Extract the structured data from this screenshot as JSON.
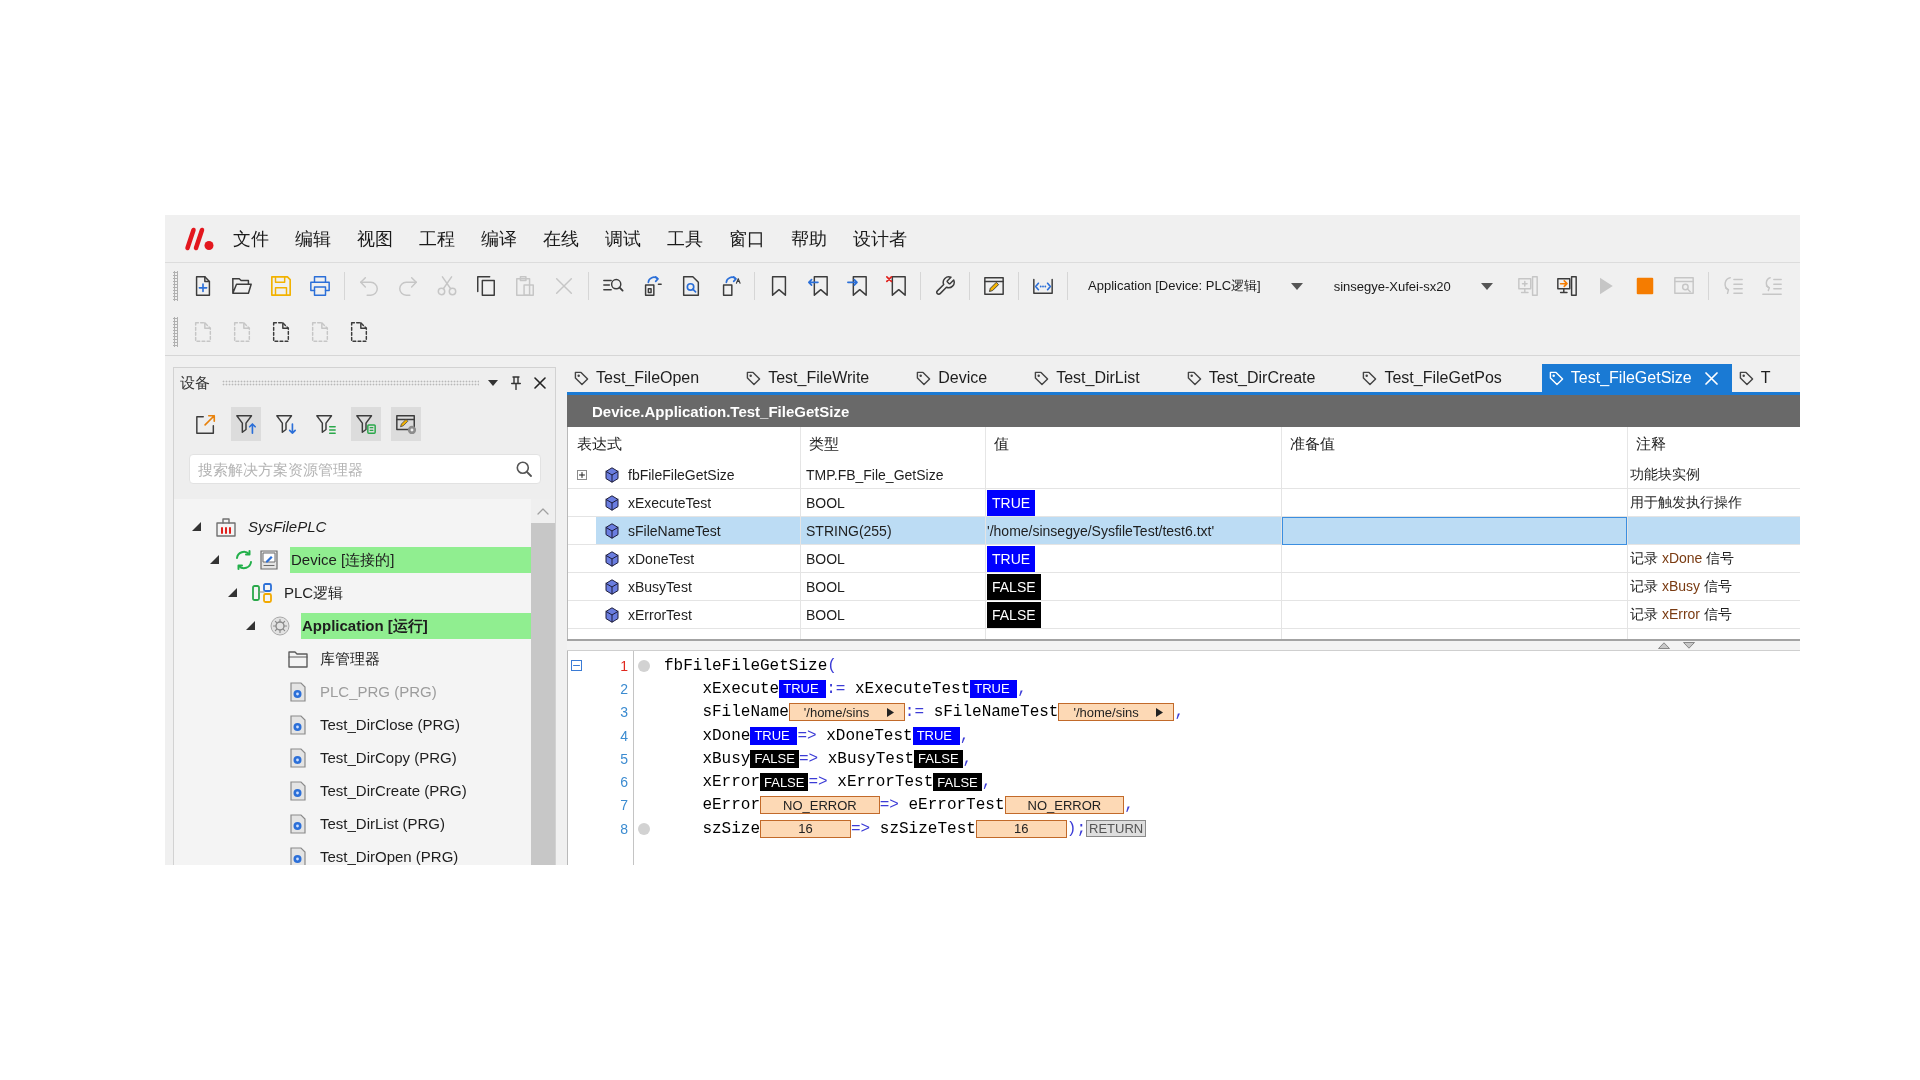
{
  "menu": [
    "文件",
    "编辑",
    "视图",
    "工程",
    "编译",
    "在线",
    "调试",
    "工具",
    "窗口",
    "帮助",
    "设计者"
  ],
  "toolbar": {
    "rows": [
      {
        "groups": [
          {
            "items": [
              {
                "kind": "new",
                "disabled": false
              },
              {
                "kind": "open",
                "disabled": false
              },
              {
                "kind": "save",
                "disabled": false
              },
              {
                "kind": "print",
                "disabled": false
              }
            ]
          },
          {
            "items": [
              {
                "kind": "undo",
                "disabled": true
              },
              {
                "kind": "redo",
                "disabled": true
              },
              {
                "kind": "cut",
                "disabled": true
              },
              {
                "kind": "copy",
                "disabled": false
              },
              {
                "kind": "paste",
                "disabled": true
              },
              {
                "kind": "delete",
                "disabled": true
              }
            ]
          },
          {
            "items": [
              {
                "kind": "find",
                "disabled": false
              },
              {
                "kind": "box_arrow",
                "disabled": false
              },
              {
                "kind": "page_search",
                "disabled": false
              },
              {
                "kind": "page_arrow",
                "disabled": false
              }
            ]
          },
          {
            "items": [
              {
                "kind": "bookmark",
                "disabled": false
              },
              {
                "kind": "bookmark_prev",
                "disabled": false
              },
              {
                "kind": "bookmark_next",
                "disabled": false
              },
              {
                "kind": "bookmark_clear",
                "disabled": false
              }
            ]
          },
          {
            "items": [
              {
                "kind": "wrench",
                "disabled": false
              }
            ]
          },
          {
            "items": [
              {
                "kind": "window_pencil",
                "disabled": false
              }
            ]
          },
          {
            "items": [
              {
                "kind": "code_bracket",
                "disabled": false
              }
            ]
          },
          {
            "items": [
              {
                "kind": "dropdown",
                "text": "Application [Device: PLC逻辑]"
              },
              {
                "kind": "dropdown",
                "text": "sinsegye-Xufei-sx20"
              },
              {
                "kind": "login",
                "disabled": true
              },
              {
                "kind": "logout",
                "disabled": false
              },
              {
                "kind": "run",
                "disabled": true
              },
              {
                "kind": "stop",
                "disabled": false
              },
              {
                "kind": "window_search",
                "disabled": true
              }
            ]
          },
          {
            "items": [
              {
                "kind": "step_into",
                "disabled": true
              },
              {
                "kind": "step_over",
                "disabled": true
              }
            ]
          }
        ]
      },
      {
        "groups": [
          {
            "items": [
              {
                "kind": "dashed_page",
                "disabled": true
              },
              {
                "kind": "dashed_page",
                "disabled": true
              },
              {
                "kind": "dashed_page",
                "disabled": false
              },
              {
                "kind": "dashed_page",
                "disabled": true
              },
              {
                "kind": "dashed_page",
                "disabled": false
              }
            ]
          }
        ]
      }
    ]
  },
  "devices": {
    "title": "设备",
    "tools": [
      {
        "kind": "export",
        "active": false
      },
      {
        "kind": "filter_up",
        "active": true
      },
      {
        "kind": "filter_down",
        "active": false
      },
      {
        "kind": "filter_lines",
        "active": false
      },
      {
        "kind": "filter_box",
        "active": true
      },
      {
        "kind": "window_gear",
        "active": true
      }
    ],
    "search": {
      "placeholder": "搜索解决方案资源管理器"
    },
    "tree": [
      {
        "label": "SysFilePLC",
        "kind": "project",
        "highlighted": false,
        "disabled": false,
        "active": false,
        "expanded": true,
        "children": [
          {
            "label": "Device [连接的]",
            "kind": "device",
            "highlighted": true,
            "disabled": false,
            "active": false,
            "expanded": true,
            "children": [
              {
                "label": "PLC逻辑",
                "kind": "plc_logic",
                "highlighted": false,
                "disabled": false,
                "active": false,
                "expanded": true,
                "children": [
                  {
                    "label": "Application [运行]",
                    "kind": "application",
                    "highlighted": true,
                    "disabled": false,
                    "active": true,
                    "expanded": true,
                    "children": [
                      {
                        "label": "库管理器",
                        "kind": "library",
                        "highlighted": false,
                        "disabled": false,
                        "active": false
                      },
                      {
                        "label": "PLC_PRG (PRG)",
                        "kind": "program",
                        "highlighted": false,
                        "disabled": true,
                        "active": false
                      },
                      {
                        "label": "Test_DirClose (PRG)",
                        "kind": "program",
                        "highlighted": false,
                        "disabled": false,
                        "active": false
                      },
                      {
                        "label": "Test_DirCopy (PRG)",
                        "kind": "program",
                        "highlighted": false,
                        "disabled": false,
                        "active": false
                      },
                      {
                        "label": "Test_DirCreate (PRG)",
                        "kind": "program",
                        "highlighted": false,
                        "disabled": false,
                        "active": false
                      },
                      {
                        "label": "Test_DirList (PRG)",
                        "kind": "program",
                        "highlighted": false,
                        "disabled": false,
                        "active": false
                      },
                      {
                        "label": "Test_DirOpen (PRG)",
                        "kind": "program",
                        "highlighted": false,
                        "disabled": false,
                        "active": false
                      }
                    ]
                  }
                ]
              }
            ]
          }
        ]
      }
    ]
  },
  "tabs": [
    {
      "label": "Test_FileOpen",
      "selected": false
    },
    {
      "label": "Test_FileWrite",
      "selected": false
    },
    {
      "label": "Device",
      "selected": false
    },
    {
      "label": "Test_DirList",
      "selected": false
    },
    {
      "label": "Test_DirCreate",
      "selected": false
    },
    {
      "label": "Test_FileGetPos",
      "selected": false
    },
    {
      "label": "Test_FileGetSize",
      "selected": true
    },
    {
      "label": "T",
      "selected": false
    }
  ],
  "editor": {
    "title": "Device.Application.Test_FileGetSize",
    "columns": [
      "表达式",
      "类型",
      "值",
      "准备值",
      "注释"
    ],
    "rows": [
      {
        "expression": "fbFileFileGetSize",
        "type": "TMP.FB_File_GetSize",
        "expanded": false,
        "selected": false,
        "comment": [
          {
            "text": "功能块实例",
            "kind": "text"
          }
        ]
      },
      {
        "expression": "xExecuteTest",
        "type": "BOOL",
        "value": {
          "text": "TRUE",
          "kind": "true"
        },
        "selected": false,
        "comment": [
          {
            "text": "用于触发执行操作",
            "kind": "text"
          }
        ]
      },
      {
        "expression": "sFileNameTest",
        "type": "STRING(255)",
        "value": {
          "text": "'/home/sinsegye/SysfileTest/test6.txt'",
          "kind": "text"
        },
        "selected": true
      },
      {
        "expression": "xDoneTest",
        "type": "BOOL",
        "value": {
          "text": "TRUE",
          "kind": "true"
        },
        "selected": false,
        "comment": [
          {
            "text": "记录 ",
            "kind": "text"
          },
          {
            "text": "xDone",
            "kind": "identifier"
          },
          {
            "text": " 信号",
            "kind": "text"
          }
        ]
      },
      {
        "expression": "xBusyTest",
        "type": "BOOL",
        "value": {
          "text": "FALSE",
          "kind": "false"
        },
        "selected": false,
        "comment": [
          {
            "text": "记录 ",
            "kind": "text"
          },
          {
            "text": "xBusy",
            "kind": "identifier"
          },
          {
            "text": " 信号",
            "kind": "text"
          }
        ]
      },
      {
        "expression": "xErrorTest",
        "type": "BOOL",
        "value": {
          "text": "FALSE",
          "kind": "false"
        },
        "selected": false,
        "comment": [
          {
            "text": "记录 ",
            "kind": "text"
          },
          {
            "text": "xError",
            "kind": "identifier"
          },
          {
            "text": " 信号",
            "kind": "text"
          }
        ]
      }
    ],
    "code": [
      {
        "number": "1",
        "current": true,
        "breakpoint": true,
        "expanded": true,
        "tokens": [
          {
            "text": "fbFileFileGetSize",
            "kind": "ident"
          },
          {
            "text": "(",
            "kind": "op"
          }
        ],
        "children": [
          {
            "number": "2",
            "current": false,
            "breakpoint": false,
            "tokens": [
              {
                "text": "xExecute",
                "kind": "ident"
              },
              {
                "text": "TRUE",
                "kind": "true"
              },
              {
                "text": ":= ",
                "kind": "op"
              },
              {
                "text": "xExecuteTest",
                "kind": "ident"
              },
              {
                "text": "TRUE",
                "kind": "true"
              },
              {
                "text": ",",
                "kind": "op"
              }
            ]
          },
          {
            "number": "3",
            "current": false,
            "breakpoint": false,
            "tokens": [
              {
                "text": "sFileName",
                "kind": "ident"
              },
              {
                "text": "'/home/sins",
                "kind": "string"
              },
              {
                "text": ":= ",
                "kind": "op"
              },
              {
                "text": "sFileNameTest",
                "kind": "ident"
              },
              {
                "text": "'/home/sins",
                "kind": "string"
              },
              {
                "text": ",",
                "kind": "op"
              }
            ]
          },
          {
            "number": "4",
            "current": false,
            "breakpoint": false,
            "tokens": [
              {
                "text": "xDone",
                "kind": "ident"
              },
              {
                "text": "TRUE",
                "kind": "true"
              },
              {
                "text": "=> ",
                "kind": "op"
              },
              {
                "text": "xDoneTest",
                "kind": "ident"
              },
              {
                "text": "TRUE",
                "kind": "true"
              },
              {
                "text": ",",
                "kind": "op"
              }
            ]
          },
          {
            "number": "5",
            "current": false,
            "breakpoint": false,
            "tokens": [
              {
                "text": "xBusy",
                "kind": "ident"
              },
              {
                "text": "FALSE",
                "kind": "false"
              },
              {
                "text": "=> ",
                "kind": "op"
              },
              {
                "text": "xBusyTest",
                "kind": "ident"
              },
              {
                "text": "FALSE",
                "kind": "false"
              },
              {
                "text": ",",
                "kind": "op"
              }
            ]
          },
          {
            "number": "6",
            "current": false,
            "breakpoint": false,
            "tokens": [
              {
                "text": "xError",
                "kind": "ident"
              },
              {
                "text": "FALSE",
                "kind": "false"
              },
              {
                "text": "=> ",
                "kind": "op"
              },
              {
                "text": "xErrorTest",
                "kind": "ident"
              },
              {
                "text": "FALSE",
                "kind": "false"
              },
              {
                "text": ",",
                "kind": "op"
              }
            ]
          },
          {
            "number": "7",
            "current": false,
            "breakpoint": false,
            "tokens": [
              {
                "text": "eError",
                "kind": "ident"
              },
              {
                "text": "NO_ERROR",
                "kind": "value"
              },
              {
                "text": "=> ",
                "kind": "op"
              },
              {
                "text": "eErrorTest",
                "kind": "ident"
              },
              {
                "text": "NO_ERROR",
                "kind": "value"
              },
              {
                "text": ",",
                "kind": "op"
              }
            ]
          },
          {
            "number": "8",
            "current": false,
            "breakpoint": true,
            "tokens": [
              {
                "text": "szSize",
                "kind": "ident"
              },
              {
                "text": "16",
                "kind": "value"
              },
              {
                "text": "=> ",
                "kind": "op"
              },
              {
                "text": "szSizeTest",
                "kind": "ident"
              },
              {
                "text": "16",
                "kind": "value"
              },
              {
                "text": ");",
                "kind": "op"
              },
              {
                "text": "RETURN",
                "kind": "return"
              }
            ]
          }
        ]
      }
    ]
  }
}
